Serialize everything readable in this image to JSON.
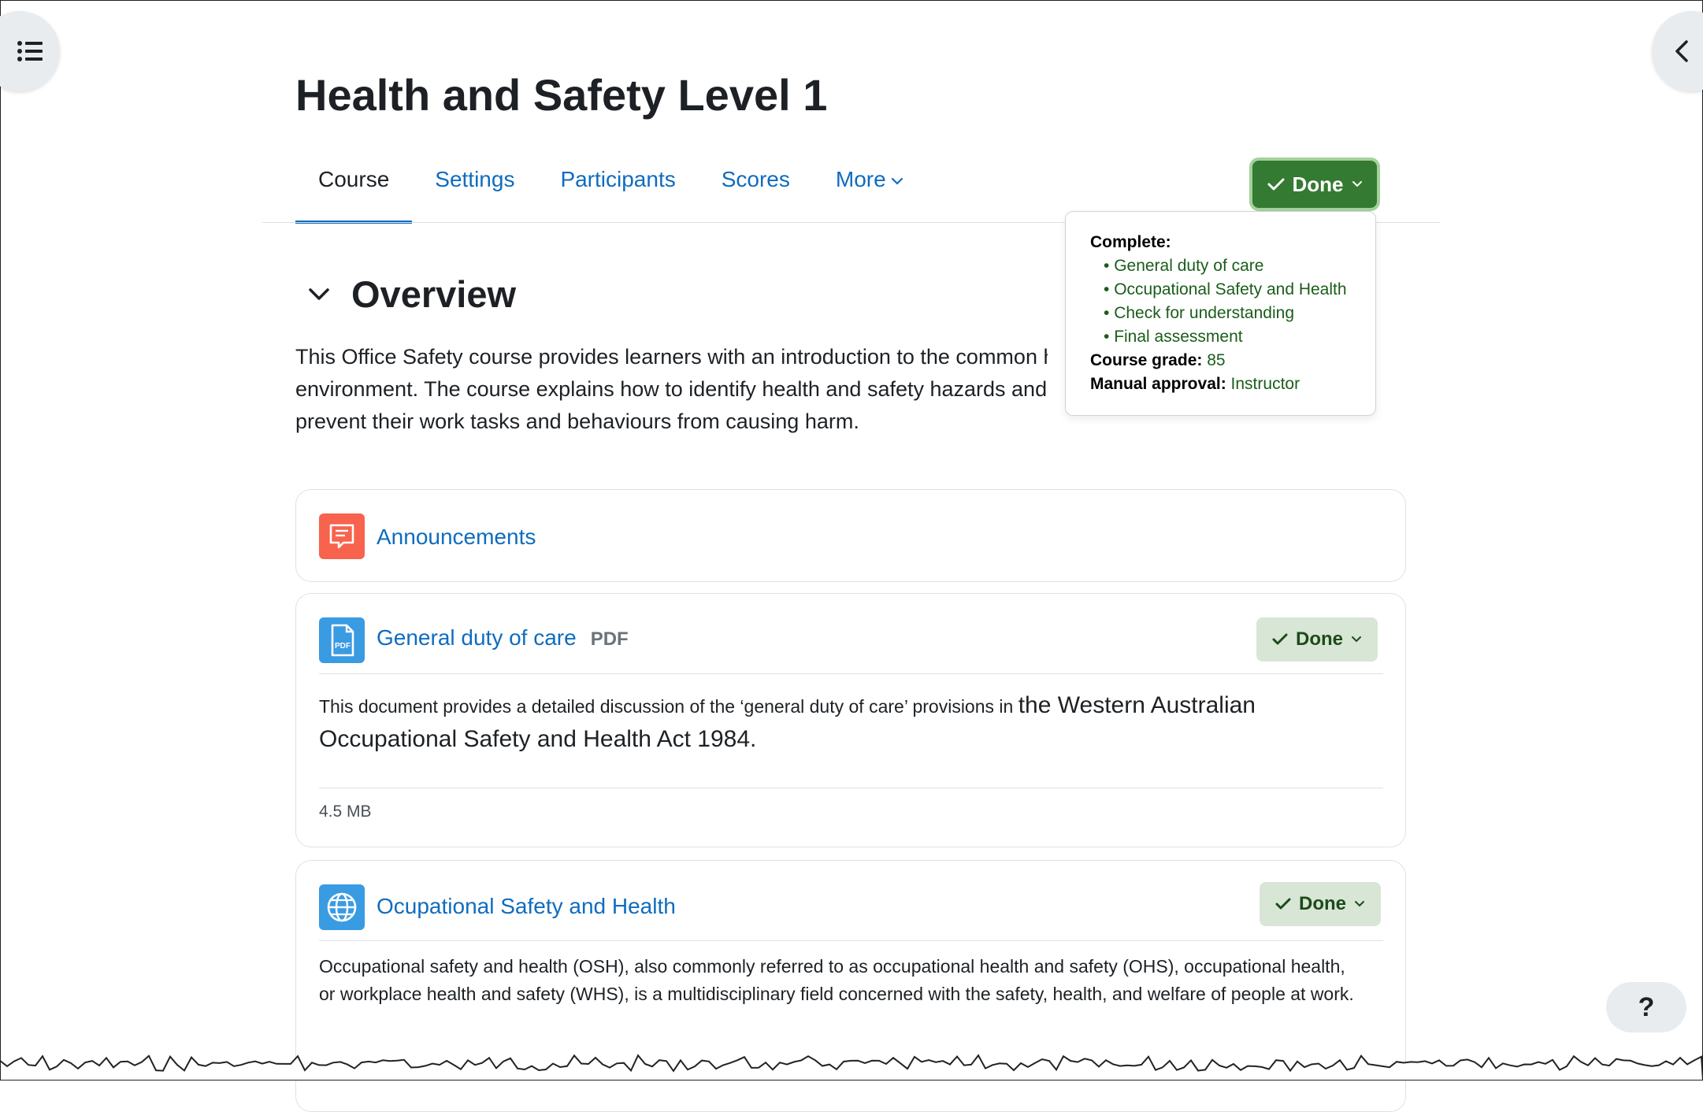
{
  "course": {
    "title": "Health and Safety Level 1"
  },
  "nav": {
    "tabs": [
      "Course",
      "Settings",
      "Participants",
      "Scores",
      "More"
    ]
  },
  "completion": {
    "button_label": "Done",
    "popover": {
      "complete_label": "Complete:",
      "items": [
        "General duty of care",
        "Occupational Safety and Health",
        "Check for understanding",
        "Final assessment"
      ],
      "grade_label": "Course grade:",
      "grade_value": "85",
      "approval_label": "Manual approval:",
      "approval_value": "Instructor"
    }
  },
  "section": {
    "title": "Overview",
    "summary": "This Office Safety course provides learners with an introduction to the common hazards in an office environment. The course explains how to identify health and safety hazards and what workers can do to prevent their work tasks and behaviours from causing harm."
  },
  "activities": [
    {
      "name": "Announcements",
      "icon": "forum-icon",
      "color": "#f7634d"
    },
    {
      "name": "General duty of care",
      "badge": "PDF",
      "icon": "pdf-icon",
      "color": "#399be2",
      "done_label": "Done",
      "desc_small": "This document provides a detailed discussion of the ‘general duty of care’ provisions in",
      "desc_large": "the Western Australian Occupational Safety and Health Act 1984.",
      "file_size": "4.5 MB"
    },
    {
      "name": "Ocupational Safety and Health",
      "icon": "globe-icon",
      "color": "#399be2",
      "done_label": "Done",
      "desc": "Occupational safety and health (OSH), also commonly referred to as occupational health and safety (OHS), occupational health, or workplace health and safety (WHS), is a multidisciplinary field concerned with the safety, health, and welfare of people at work."
    }
  ],
  "help": {
    "label": "?"
  },
  "colors": {
    "link": "#0f6cbf",
    "done_dark": "#357a32",
    "done_light": "#d7e6d5"
  }
}
